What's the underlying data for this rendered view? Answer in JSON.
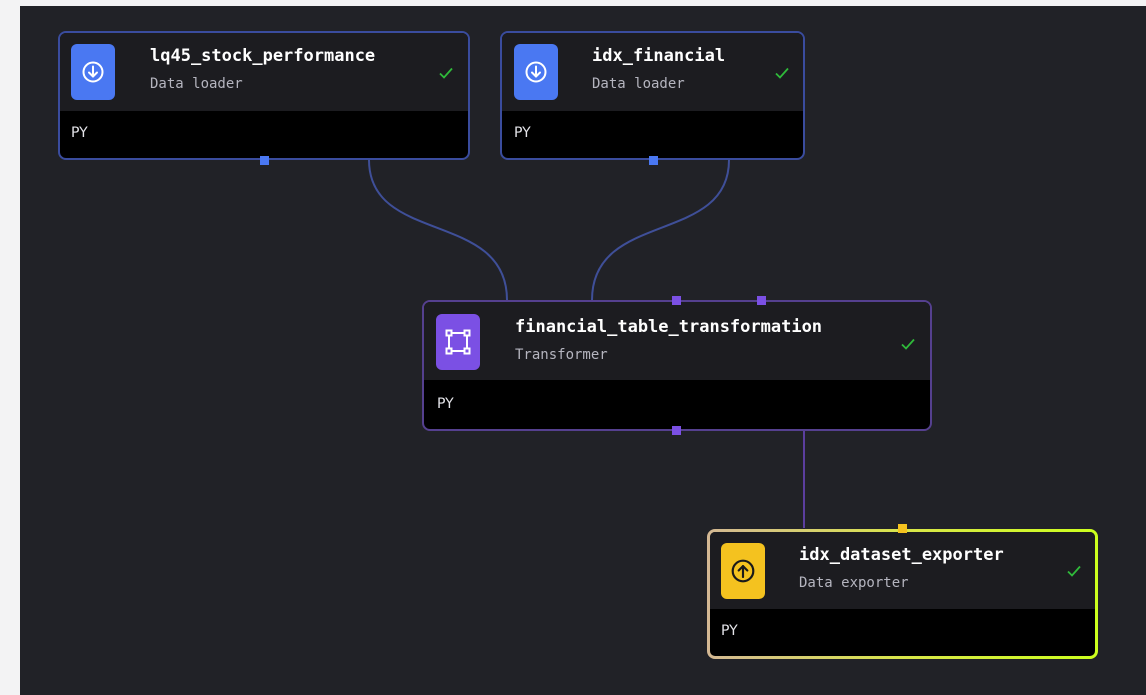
{
  "blocks": [
    {
      "id": "lq45",
      "title": "lq45_stock_performance",
      "type": "Data loader",
      "language": "PY",
      "status": "success"
    },
    {
      "id": "idxfin",
      "title": "idx_financial",
      "type": "Data loader",
      "language": "PY",
      "status": "success"
    },
    {
      "id": "transform",
      "title": "financial_table_transformation",
      "type": "Transformer",
      "language": "PY",
      "status": "success"
    },
    {
      "id": "exporter",
      "title": "idx_dataset_exporter",
      "type": "Data exporter",
      "language": "PY",
      "status": "success"
    }
  ],
  "colors": {
    "loader": "#4a78f2",
    "transformer": "#7b50e4",
    "exporter": "#f4c21f",
    "success": "#2fba3a",
    "canvas": "#212227"
  },
  "icons": {
    "loader": "download-arrow-icon",
    "transformer": "transform-square-icon",
    "exporter": "upload-arrow-icon",
    "status": "checkmark-icon"
  }
}
